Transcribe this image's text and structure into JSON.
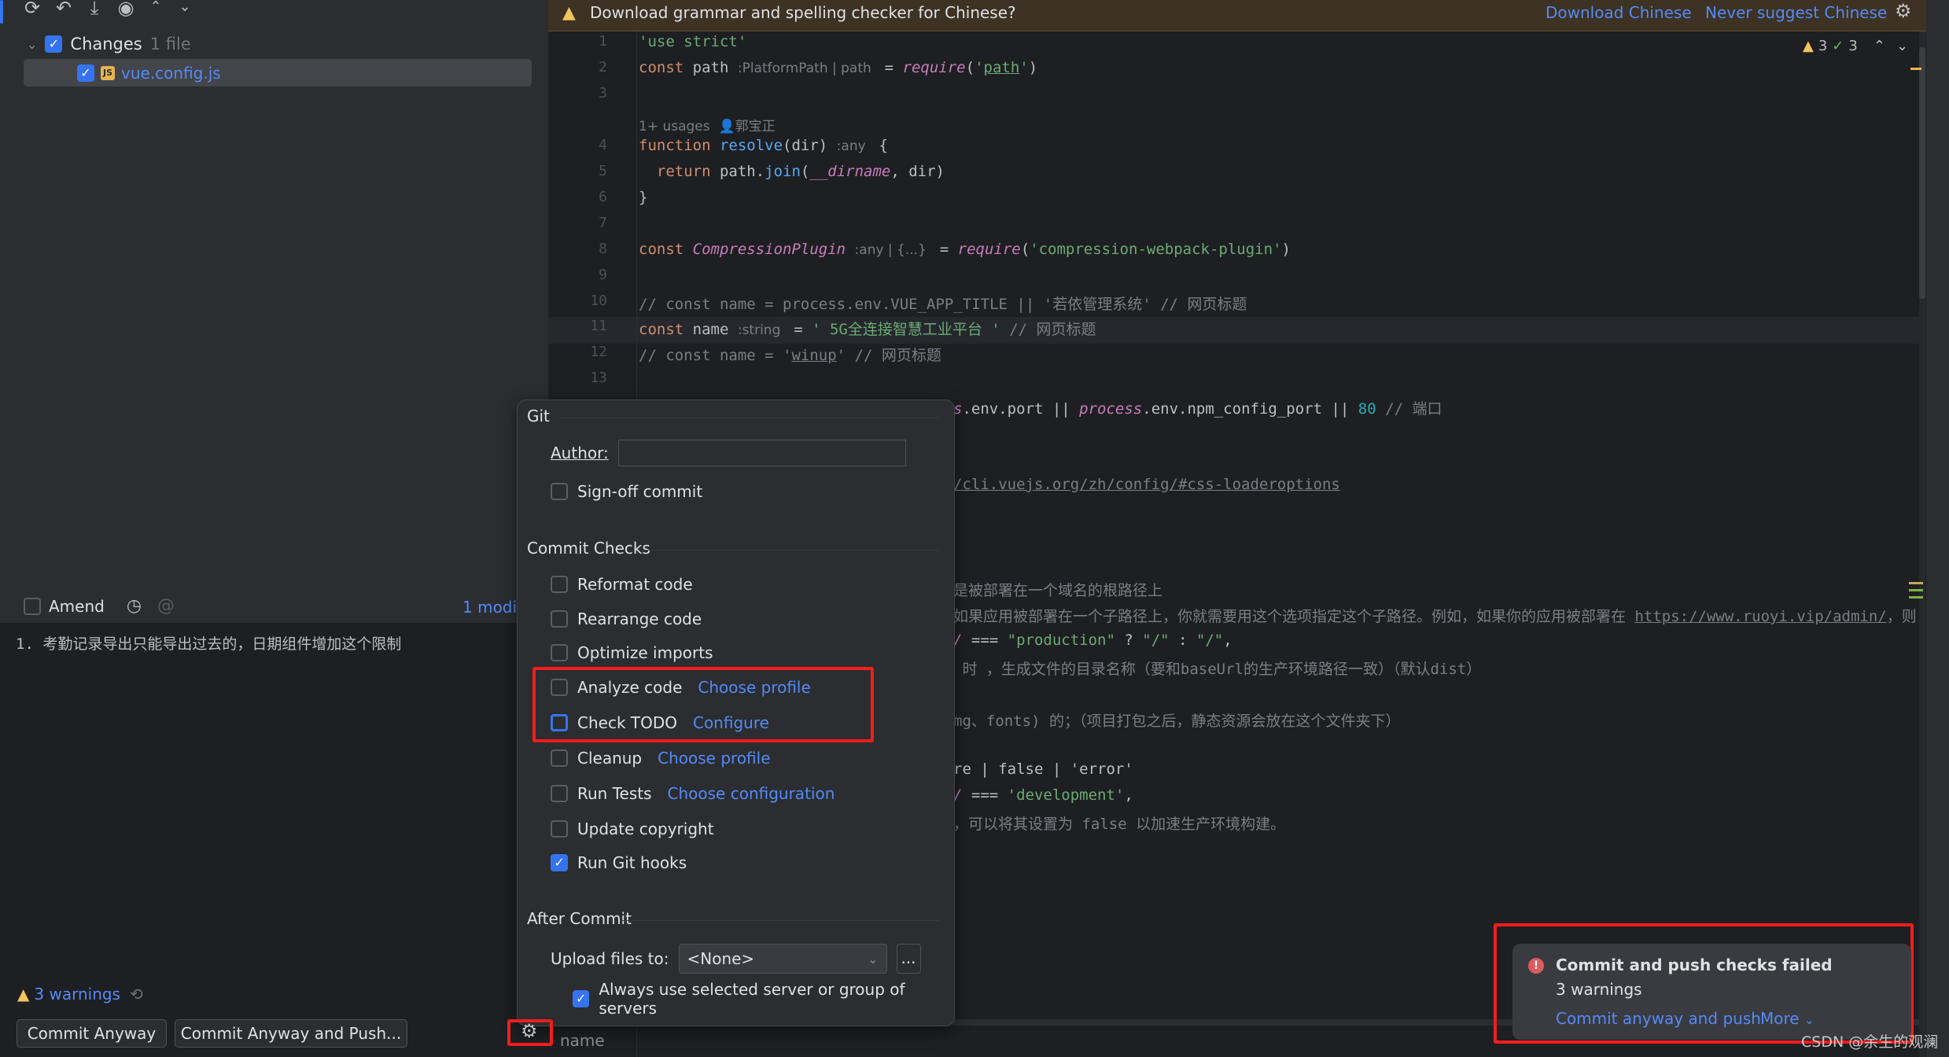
{
  "toolbar": {
    "icons": [
      "refresh-icon",
      "rollback-icon",
      "shelve-icon",
      "preview-diff-icon",
      "expand-all-icon",
      "collapse-all-icon"
    ]
  },
  "changes": {
    "group_label": "Changes",
    "group_count": "1 file",
    "file": "vue.config.js",
    "file_icon_label": "JS",
    "group_checked": true,
    "file_checked": true
  },
  "commit": {
    "amend_label": "Amend",
    "amend_checked": false,
    "modified_label": "1 modif",
    "message": "1. 考勤记录导出只能导出过去的，日期组件增加这个限制",
    "warnings": "3 warnings",
    "commit_anyway": "Commit Anyway",
    "commit_anyway_push": "Commit Anyway and Push..."
  },
  "banner": {
    "text": "Download grammar and spelling checker for Chinese?",
    "download": "Download Chinese",
    "never": "Never suggest Chinese"
  },
  "inspection": {
    "warnings": "3",
    "weak": "3"
  },
  "editor": {
    "usages": "1+ usages",
    "author": "郭宝正",
    "lines": [
      {
        "n": "1",
        "tok": [
          [
            "s",
            "'use strict'"
          ]
        ]
      },
      {
        "n": "2",
        "tok": [
          [
            "k",
            "const "
          ],
          [
            "d",
            "path "
          ],
          [
            "h",
            ":PlatformPath | path "
          ],
          [
            "d",
            " = "
          ],
          [
            "p",
            "require"
          ],
          [
            "d",
            "("
          ],
          [
            "s",
            "'"
          ],
          [
            "s u",
            "path"
          ],
          [
            "s",
            "'"
          ],
          [
            "d",
            ")"
          ]
        ]
      },
      {
        "n": "3",
        "tok": []
      },
      {
        "n": "4",
        "tok": [
          [
            "k",
            "function "
          ],
          [
            "f",
            "resolve"
          ],
          [
            "d",
            "(dir) "
          ],
          [
            "h",
            ":any "
          ],
          [
            "d",
            " {"
          ]
        ]
      },
      {
        "n": "5",
        "tok": [
          [
            "k",
            "  return "
          ],
          [
            "d",
            "path."
          ],
          [
            "f",
            "join"
          ],
          [
            "d",
            "("
          ],
          [
            "p",
            "__dirname"
          ],
          [
            "d",
            ", dir)"
          ]
        ]
      },
      {
        "n": "6",
        "tok": [
          [
            "d",
            "}"
          ]
        ]
      },
      {
        "n": "7",
        "tok": []
      },
      {
        "n": "8",
        "tok": [
          [
            "k",
            "const "
          ],
          [
            "p",
            "CompressionPlugin "
          ],
          [
            "h",
            ":any | {...} "
          ],
          [
            "d",
            " = "
          ],
          [
            "p",
            "require"
          ],
          [
            "d",
            "("
          ],
          [
            "s",
            "'compression-webpack-plugin'"
          ],
          [
            "d",
            ")"
          ]
        ]
      },
      {
        "n": "9",
        "tok": []
      },
      {
        "n": "10",
        "tok": [
          [
            "c",
            "// const name = process.env.VUE_APP_TITLE || '若依管理系统' // 网页标题"
          ]
        ]
      },
      {
        "n": "11",
        "tok": [
          [
            "k",
            "const "
          ],
          [
            "d",
            "name "
          ],
          [
            "h",
            ":string "
          ],
          [
            "d",
            " = "
          ],
          [
            "s",
            "' 5G全连接智慧工业平台 '"
          ],
          [
            "c",
            " // 网页标题"
          ]
        ]
      },
      {
        "n": "12",
        "tok": [
          [
            "c",
            "// const name = '"
          ],
          [
            "c u",
            "winup"
          ],
          [
            "c",
            "' // 网页标题"
          ]
        ]
      },
      {
        "n": "13",
        "tok": []
      }
    ],
    "fragments": [
      [
        [
          "p",
          "s"
        ],
        [
          "d",
          ".env.port || "
        ],
        [
          "p",
          "process"
        ],
        [
          "d",
          ".env.npm_config_port || "
        ],
        [
          "n",
          "80"
        ],
        [
          "c",
          " // 端口"
        ]
      ],
      [
        [
          "c u",
          "/cli.vuejs.org/zh/config/#css-loaderoptions"
        ]
      ],
      [
        [
          "c",
          "是被部署在一个域名的根路径上"
        ]
      ],
      [
        [
          "c",
          "如果应用被部署在一个子路径上，你就需要用这个选项指定这个子路径。例如，如果你的应用被部署在 "
        ],
        [
          "c u",
          "https://www.ruoyi.vip/admin/"
        ],
        [
          "c",
          "，则"
        ]
      ],
      [
        [
          "p",
          "/"
        ],
        [
          "d",
          " === "
        ],
        [
          "s",
          "\"production\""
        ],
        [
          "d",
          " ? "
        ],
        [
          "s",
          "\"/\""
        ],
        [
          "d",
          " : "
        ],
        [
          "s",
          "\"/\""
        ],
        [
          "d",
          ","
        ]
      ],
      [
        [
          "c",
          " 时 ，生成文件的目录名称（要和baseUrl的生产环境路径一致）（默认dist）"
        ]
      ],
      [
        [
          "c",
          "mg、fonts) 的；（项目打包之后，静态资源会放在这个文件夹下）"
        ]
      ],
      [
        [
          "d",
          "re | false | 'error'"
        ]
      ],
      [
        [
          "p",
          "/"
        ],
        [
          "d",
          " === "
        ],
        [
          "s",
          "'development'"
        ],
        [
          "d",
          ","
        ]
      ],
      [
        [
          "c",
          "，可以将其设置为 false 以加速生产环境构建。"
        ]
      ]
    ]
  },
  "popup": {
    "git_title": "Git",
    "author_label": "Author:",
    "author_value": "",
    "signoff": "Sign-off commit",
    "checks_title": "Commit Checks",
    "checks": [
      {
        "label": "Reformat code",
        "checked": false,
        "link": ""
      },
      {
        "label": "Rearrange code",
        "checked": false,
        "link": ""
      },
      {
        "label": "Optimize imports",
        "checked": false,
        "link": ""
      },
      {
        "label": "Analyze code",
        "checked": false,
        "link": "Choose profile"
      },
      {
        "label": "Check TODO",
        "checked": false,
        "link": "Configure"
      },
      {
        "label": "Cleanup",
        "checked": false,
        "link": "Choose profile"
      },
      {
        "label": "Run Tests",
        "checked": false,
        "link": "Choose configuration"
      },
      {
        "label": "Update copyright",
        "checked": false,
        "link": ""
      },
      {
        "label": "Run Git hooks",
        "checked": true,
        "link": ""
      }
    ],
    "after_title": "After Commit",
    "upload_label": "Upload files to:",
    "upload_value": "<None>",
    "browse": "...",
    "always": "Always use selected server or group of servers",
    "always_checked": true
  },
  "bottom": {
    "name_label": "name"
  },
  "notification": {
    "title": "Commit and push checks failed",
    "subtitle": "3 warnings",
    "action": "Commit anyway and push",
    "more": "More"
  },
  "watermark": "CSDN @余生的观澜",
  "colors": {
    "accent": "#3574f0",
    "link": "#548af7",
    "annotation_red": "#f21d1d",
    "error": "#db5c5c",
    "warning": "#f2c55c"
  }
}
